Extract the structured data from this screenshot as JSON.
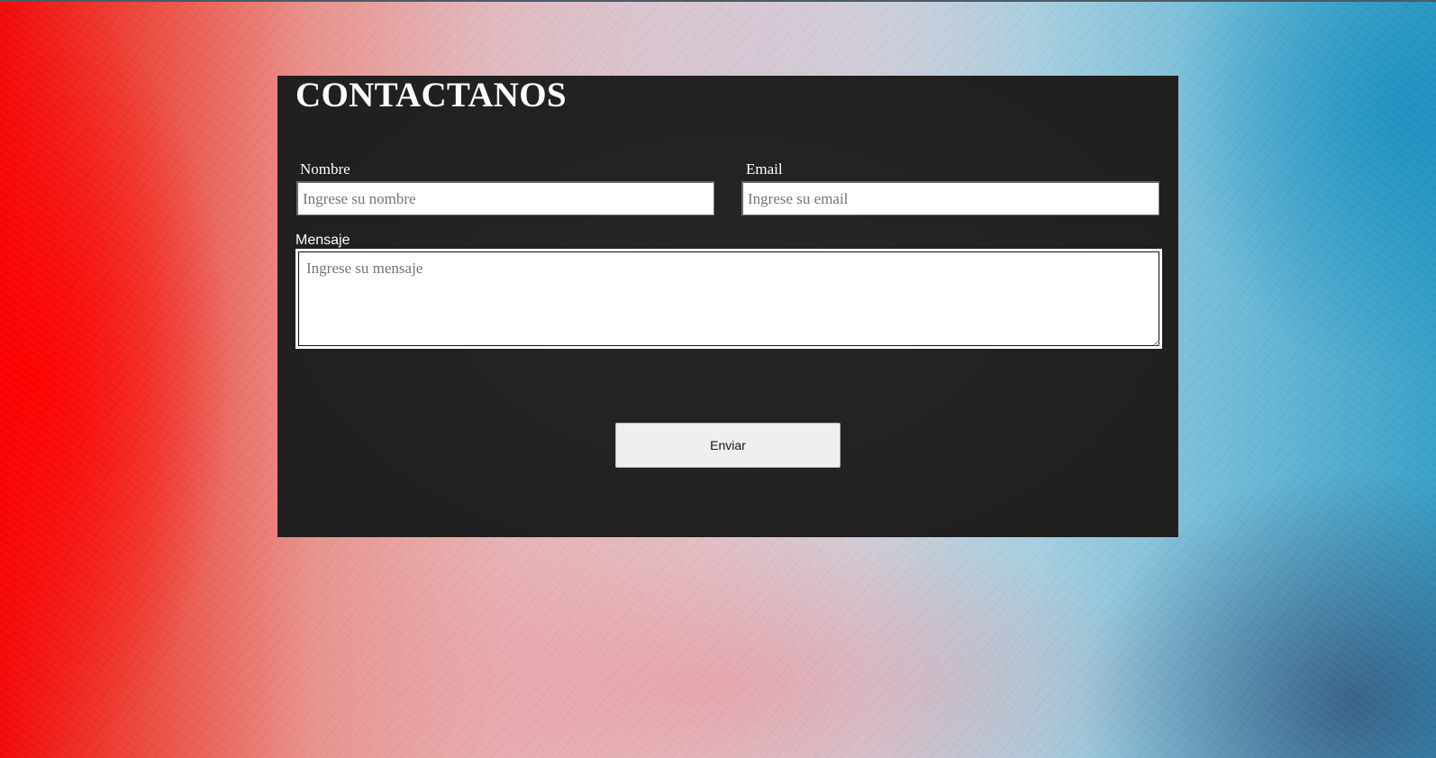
{
  "page": {
    "background_colors": {
      "left": "#f20a0a",
      "middle": "#e2c3c8",
      "right": "#3aa1c8"
    },
    "panel_color": "#272525"
  },
  "form": {
    "title": "CONTACTANOS",
    "name_label": "Nombre",
    "name_placeholder": "Ingrese su nombre",
    "email_label": "Email",
    "email_placeholder": "Ingrese su email",
    "message_label": "Mensaje",
    "message_placeholder": "Ingrese su mensaje",
    "submit_label": "Enviar"
  }
}
